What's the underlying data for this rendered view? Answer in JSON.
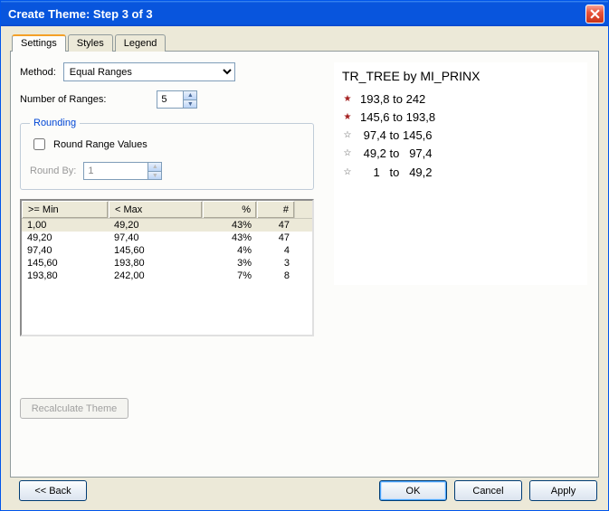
{
  "window": {
    "title": "Create Theme: Step 3 of 3"
  },
  "tabs": {
    "settings": "Settings",
    "styles": "Styles",
    "legend": "Legend"
  },
  "method": {
    "label": "Method:",
    "value": "Equal Ranges"
  },
  "numRanges": {
    "label": "Number of Ranges:",
    "value": "5"
  },
  "rounding": {
    "legend": "Rounding",
    "checkboxLabel": "Round Range Values",
    "roundByLabel": "Round By:",
    "roundByValue": "1"
  },
  "table": {
    "headers": {
      "min": ">= Min",
      "max": "< Max",
      "pct": "%",
      "cnt": "#"
    },
    "rows": [
      {
        "min": "1,00",
        "max": "49,20",
        "pct": "43%",
        "cnt": "47"
      },
      {
        "min": "49,20",
        "max": "97,40",
        "pct": "43%",
        "cnt": "47"
      },
      {
        "min": "97,40",
        "max": "145,60",
        "pct": "4%",
        "cnt": "4"
      },
      {
        "min": "145,60",
        "max": "193,80",
        "pct": "3%",
        "cnt": "3"
      },
      {
        "min": "193,80",
        "max": "242,00",
        "pct": "7%",
        "cnt": "8"
      }
    ]
  },
  "recalc": "Recalculate Theme",
  "preview": {
    "title": "TR_TREE by MI_PRINX",
    "rows": [
      {
        "filled": true,
        "text": "193,8 to 242"
      },
      {
        "filled": true,
        "text": "145,6 to 193,8"
      },
      {
        "filled": false,
        "text": " 97,4 to 145,6"
      },
      {
        "filled": false,
        "text": " 49,2 to   97,4"
      },
      {
        "filled": false,
        "text": "    1   to   49,2"
      }
    ]
  },
  "buttons": {
    "back": "<< Back",
    "ok": "OK",
    "cancel": "Cancel",
    "apply": "Apply"
  }
}
